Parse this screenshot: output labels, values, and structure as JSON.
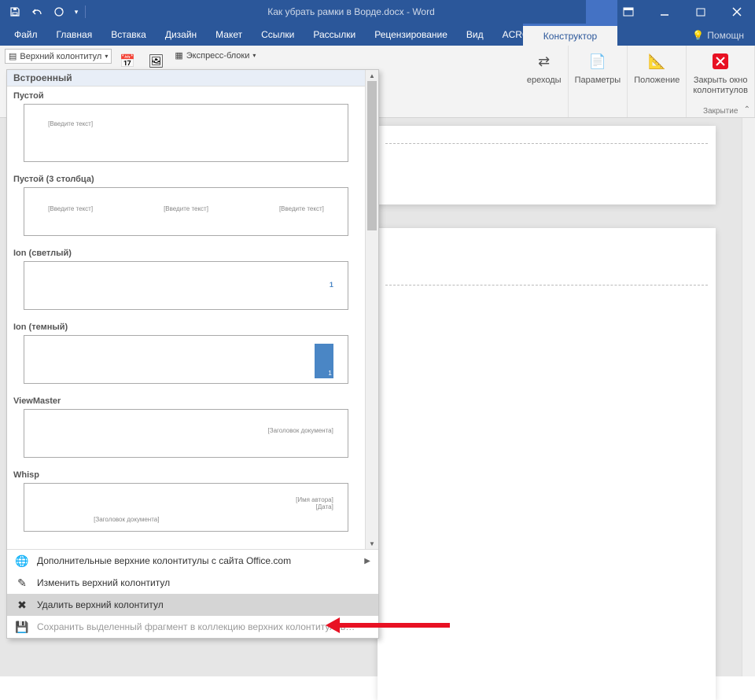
{
  "title": "Как убрать рамки в Ворде.docx - Word",
  "qat": {
    "save": "save-icon",
    "undo": "undo-icon",
    "redo": "redo-icon"
  },
  "wincontrols": {
    "ribbon_opts": "ribbon-options",
    "min": "minimize",
    "max": "maximize",
    "close": "close"
  },
  "tabs": {
    "file": "Файл",
    "home": "Главная",
    "insert": "Вставка",
    "design": "Дизайн",
    "layout": "Макет",
    "references": "Ссылки",
    "mailings": "Рассылки",
    "review": "Рецензирование",
    "view": "Вид",
    "acrobat": "ACROBAT",
    "constructor": "Конструктор"
  },
  "help": "Помощн",
  "ribbon": {
    "header_dropdown": "Верхний колонтитул",
    "express": "Экспресс-блоки",
    "transitions": "ереходы",
    "params": "Параметры",
    "position": "Положение",
    "close_hf": "Закрыть окно\nколонтитулов",
    "group_close": "Закрытие"
  },
  "dropdown": {
    "builtin": "Встроенный",
    "entries": [
      {
        "title": "Пустой",
        "ph": "[Введите текст]"
      },
      {
        "title": "Пустой (3 столбца)",
        "ph": "[Введите текст]"
      },
      {
        "title": "Ion (светлый)",
        "num": "1"
      },
      {
        "title": "Ion (темный)",
        "num": "1"
      },
      {
        "title": "ViewMaster",
        "ph": "[Заголовок документа]"
      },
      {
        "title": "Whisp",
        "author": "[Имя автора]",
        "date": "[Дата]",
        "doc": "[Заголовок документа]"
      }
    ],
    "menu": {
      "more": "Дополнительные верхние колонтитулы с сайта Office.com",
      "edit": "Изменить верхний колонтитул",
      "remove": "Удалить верхний колонтитул",
      "save": "Сохранить выделенный фрагмент в коллекцию верхних колонтитулов…"
    }
  }
}
